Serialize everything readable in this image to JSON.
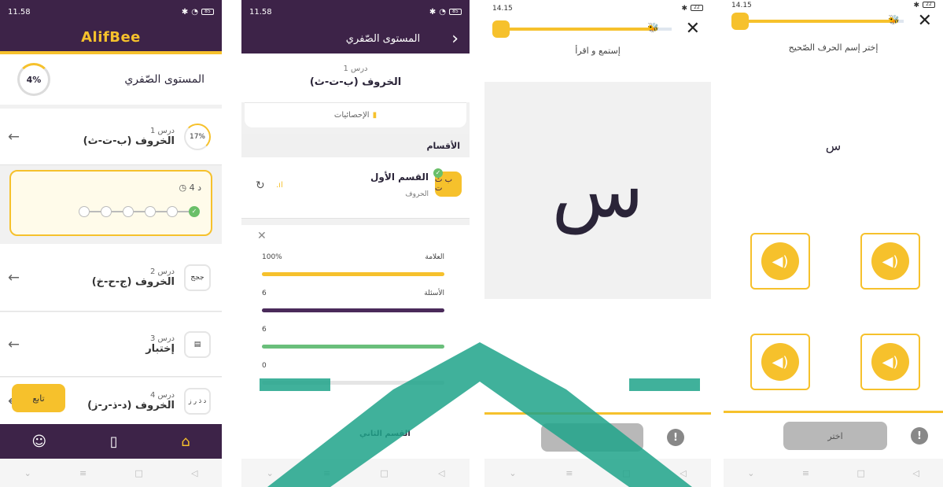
{
  "screen1": {
    "status": {
      "time": "11.58",
      "signal": "᛫ᵢₗ 185",
      "battery": "85"
    },
    "logo": "AlifBee",
    "level": {
      "title": "المستوى الصّفري",
      "percent": "4%"
    },
    "lessons": [
      {
        "sub": "درس 1",
        "title": "الخروف (ب-ت-ث)",
        "badge": "17%"
      },
      {
        "sub": "درس 2",
        "title": "الخروف (ج-ح-خ)",
        "badge": "ججج"
      },
      {
        "sub": "درس 3",
        "title": "إختبار",
        "badge": "▤"
      },
      {
        "sub": "درس 4",
        "title": "الخروف (د-ذ-ر-ز)",
        "badge": "د ذ ر ز"
      }
    ],
    "progress_box": {
      "time": "4 د"
    },
    "continue_label": "تابع"
  },
  "screen2": {
    "status": {
      "time": "11.58",
      "battery": "85"
    },
    "header_title": "المستوى الصّفري",
    "lesson_sub": "درس 1",
    "lesson_title": "الخروف (ب-ت-ث)",
    "stats_label": "الإحصائيات",
    "sections_label": "الأقسام",
    "section": {
      "title": "القسم الأول",
      "sub": "الحروف",
      "badge": "ب ث ت"
    },
    "metrics": [
      {
        "label": "العلامة",
        "value": "100%",
        "color": "#f6c12c",
        "fill": 1.0
      },
      {
        "label": "الأسئلة",
        "value": "6",
        "color": "#4a2a5a",
        "fill": 1.0
      },
      {
        "label": "",
        "value": "6",
        "color": "#6abf7b",
        "fill": 1.0
      },
      {
        "label": "",
        "value": "0",
        "color": "#d9534f",
        "fill": 0.0
      }
    ],
    "next_section": "القسم الثاني"
  },
  "screen3": {
    "status": {
      "time": "14.15",
      "battery": "22"
    },
    "prompt": "إستمع و اقرأ",
    "letter": "س",
    "progress": 0.9
  },
  "screen4": {
    "status": {
      "time": "14.15",
      "battery": "22"
    },
    "prompt": "إختر إسم الحرف الصّحيح",
    "letter": "س",
    "choose_label": "اختر",
    "progress": 0.95
  },
  "colors": {
    "purple": "#3d2348",
    "yellow": "#f6c12c",
    "green": "#6abf69"
  }
}
